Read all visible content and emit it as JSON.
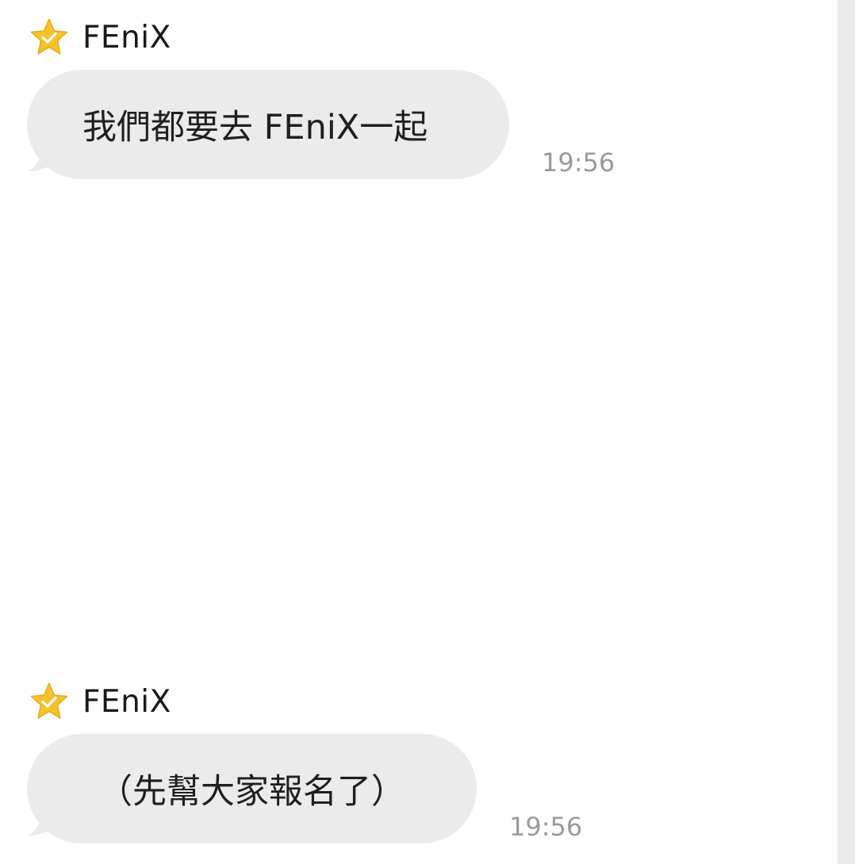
{
  "messages": [
    {
      "sender": "FEniX",
      "text": "我們都要去 FEniX一起",
      "time": "19:56"
    },
    {
      "sender": "FEniX",
      "text": "（先幫大家報名了）",
      "time": "19:56"
    }
  ],
  "colors": {
    "bubble": "#ebebeb",
    "star": "#f5c22b",
    "timestamp": "#9a9a9a",
    "scroll_rail": "#ebebeb"
  },
  "icons": {
    "sender_badge": "star-check-icon"
  }
}
